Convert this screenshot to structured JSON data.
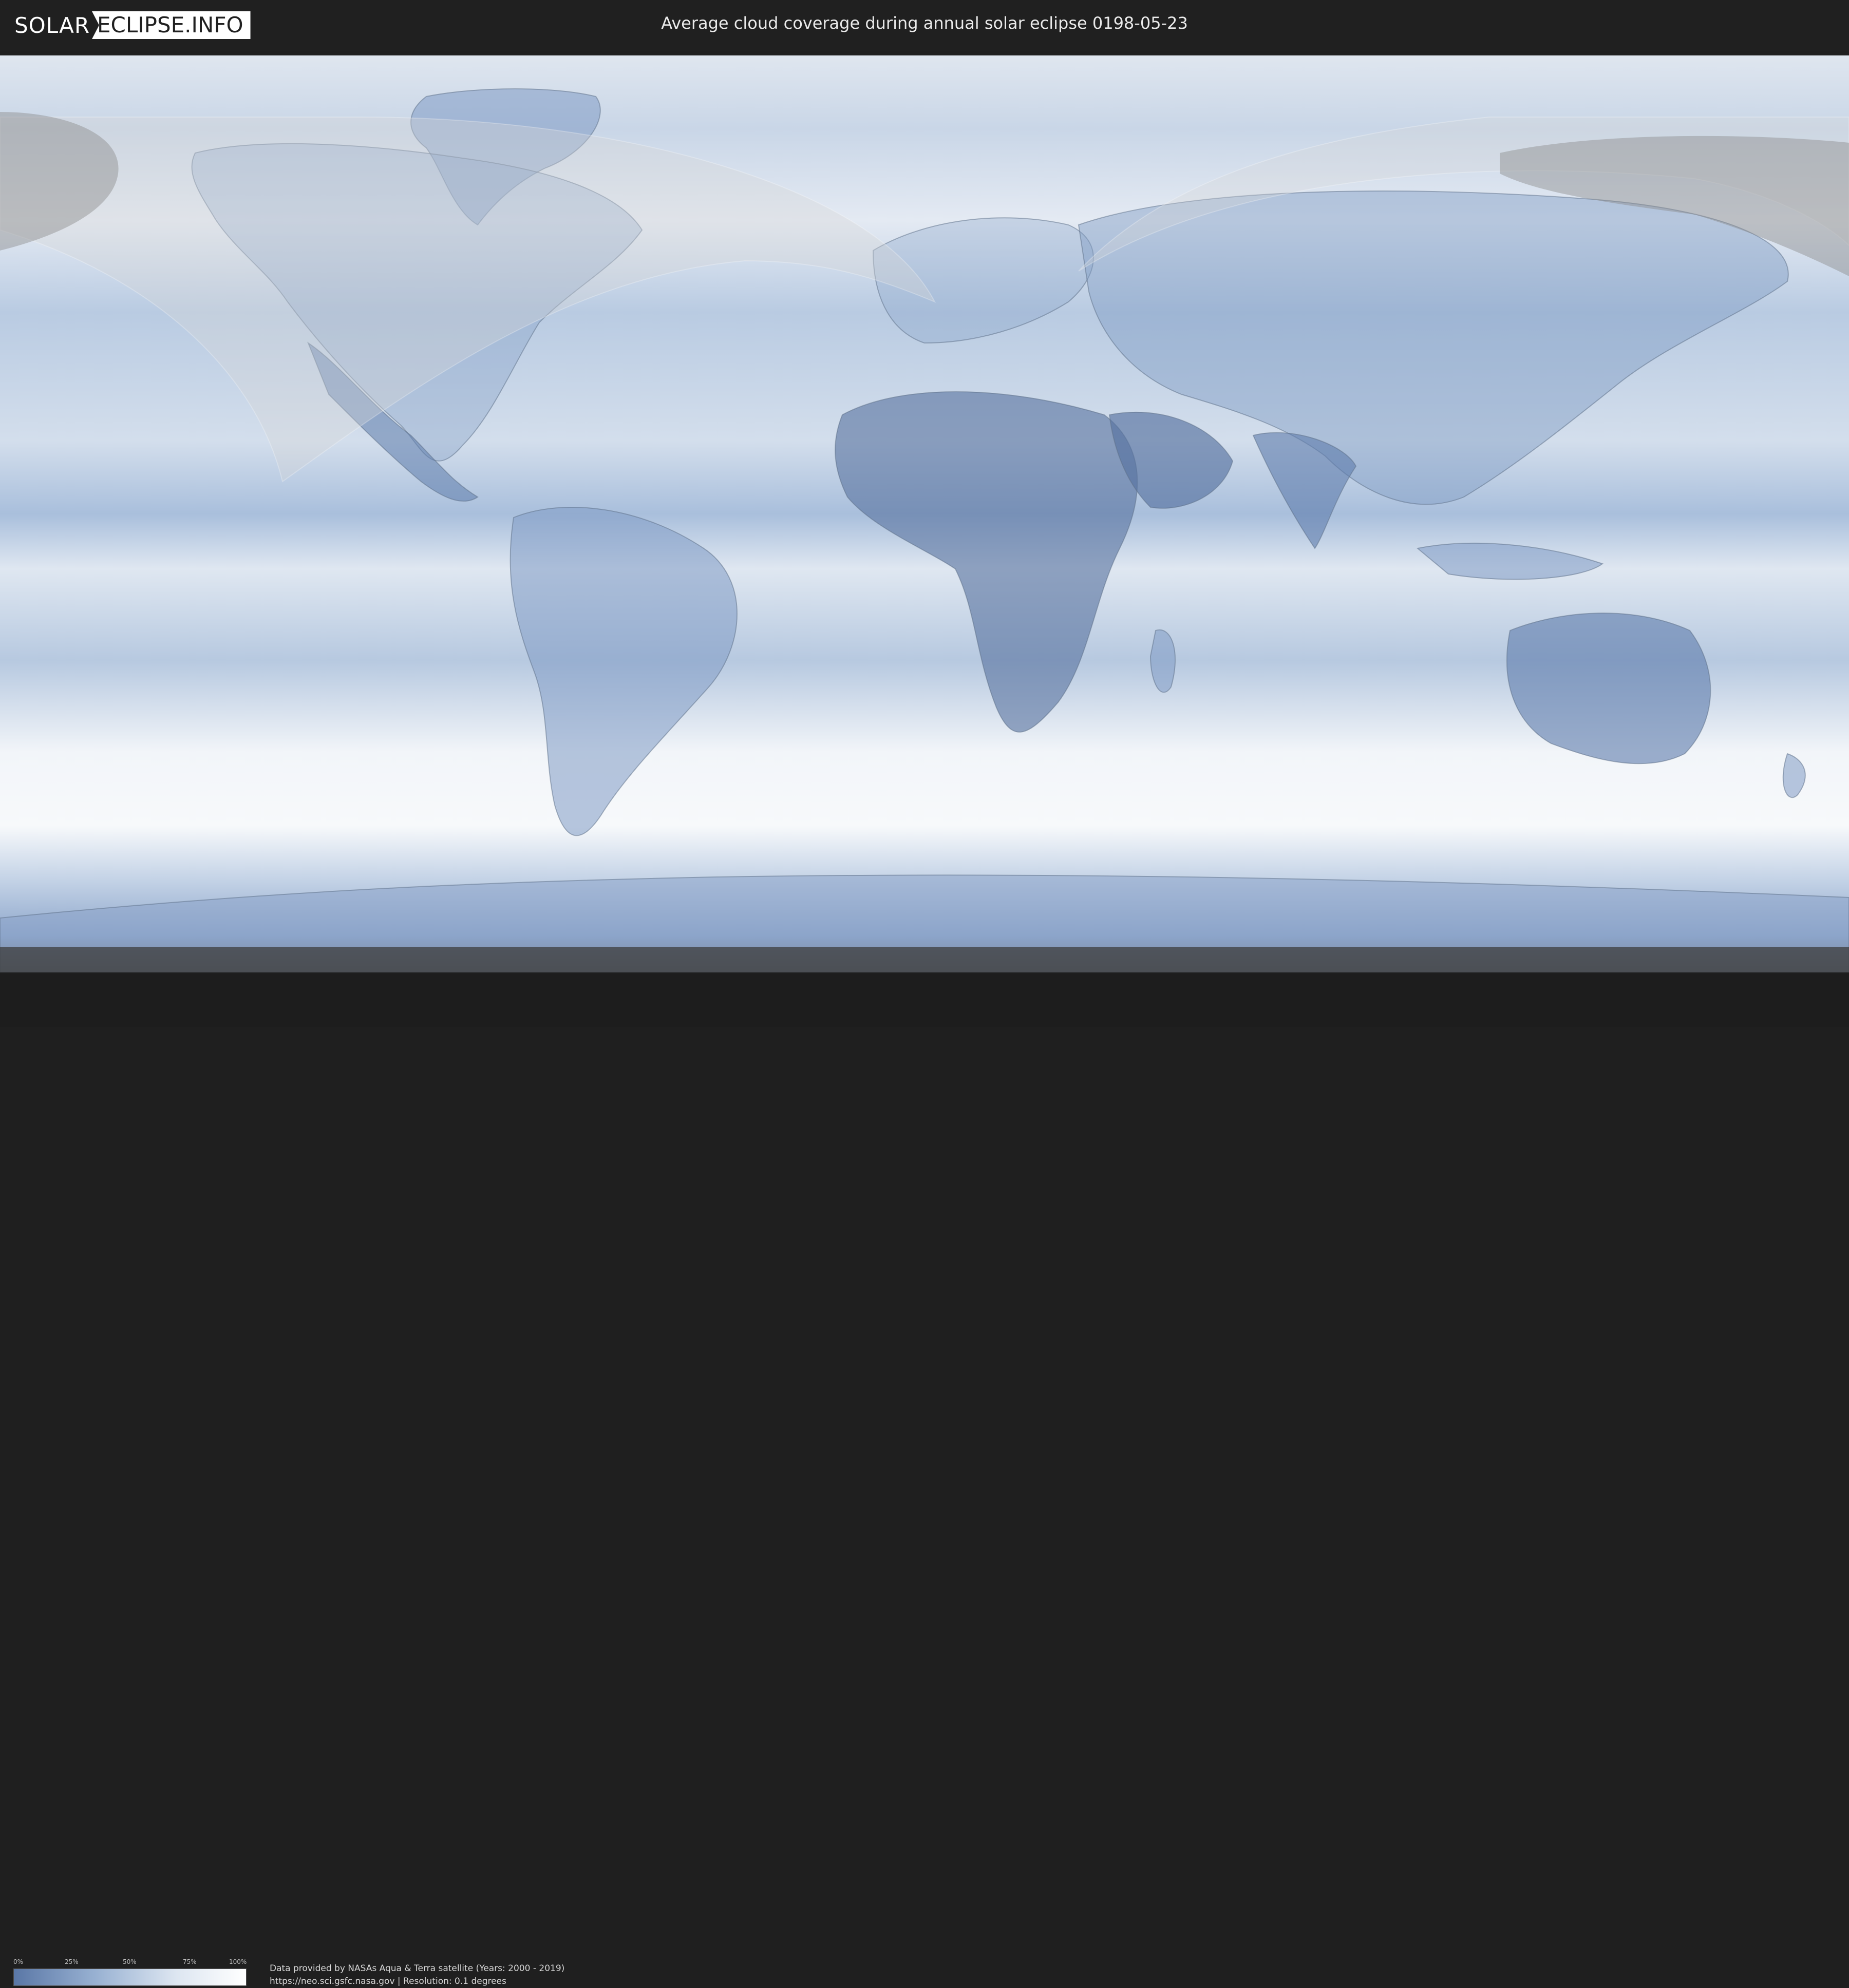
{
  "header": {
    "logo_part1": "SOLAR",
    "logo_part2": "ECLIPSE.INFO",
    "title": "Average cloud coverage during annual solar eclipse 0198-05-23"
  },
  "map": {
    "description_icon": "world-cloud-coverage-map",
    "colors": {
      "clear_sky": "#5a77a6",
      "full_cloud": "#ffffff",
      "eclipse_zone_overlay": "#d8d8d8",
      "polar_night": "#7a7a7a"
    }
  },
  "legend": {
    "ticks": [
      "0%",
      "25%",
      "50%",
      "75%",
      "100%"
    ]
  },
  "footer": {
    "credit_line1": "Data provided by NASAs Aqua & Terra satellite (Years: 2000 - 2019)",
    "credit_line2": "https://neo.sci.gsfc.nasa.gov | Resolution: 0.1 degrees"
  }
}
